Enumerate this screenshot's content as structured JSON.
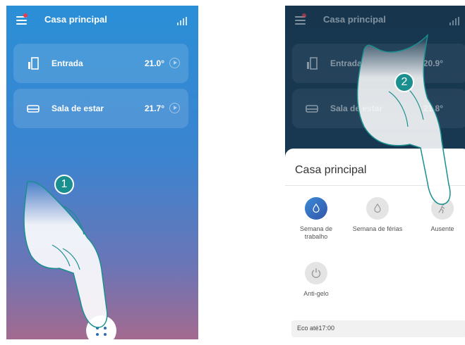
{
  "colors": {
    "accent": "#1a8f8f",
    "brand_blue": "#2a8fd6",
    "alert_dot": "#e63a4d"
  },
  "left_screen": {
    "header": {
      "title": "Casa principal",
      "menu_icon": "menu-icon",
      "signal_icon": "signal-icon"
    },
    "rooms": [
      {
        "icon": "door-icon",
        "name": "Entrada",
        "temperature": "21.0°"
      },
      {
        "icon": "sofa-icon",
        "name": "Sala de estar",
        "temperature": "21.7°"
      }
    ],
    "fab_icon": "more-dots-icon",
    "step_badge": "1"
  },
  "right_screen": {
    "header": {
      "title": "Casa principal"
    },
    "rooms": [
      {
        "icon": "door-icon",
        "name": "Entrada",
        "temperature": "20.9°"
      },
      {
        "icon": "sofa-icon",
        "name": "Sala de estar",
        "temperature": "21.8°"
      }
    ],
    "step_badge": "2",
    "sheet": {
      "title": "Casa principal",
      "modes": [
        {
          "label": "Semana de trabalho",
          "icon": "flame-drop-icon",
          "active": true
        },
        {
          "label": "Semana de férias",
          "icon": "flame-drop-icon",
          "active": false
        },
        {
          "label": "Ausente",
          "icon": "walking-person-icon",
          "active": false
        },
        {
          "label": "Anti-gelo",
          "icon": "power-icon",
          "active": false
        }
      ],
      "footer": "Eco até17:00"
    }
  }
}
